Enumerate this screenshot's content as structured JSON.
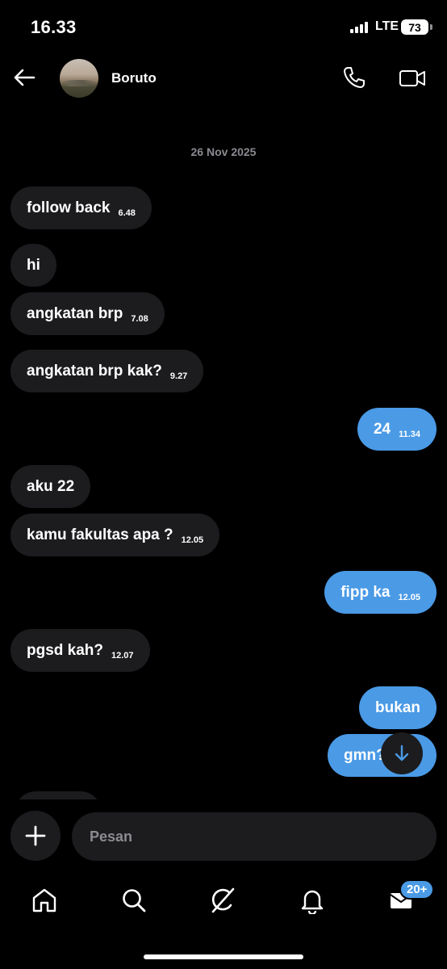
{
  "status_bar": {
    "time": "16.33",
    "network": "LTE",
    "battery": "73"
  },
  "header": {
    "contact_name": "Boruto",
    "back_icon": "arrow-left-icon",
    "call_icon": "phone-icon",
    "video_icon": "video-camera-icon"
  },
  "date_separator": "26 Nov 2025",
  "messages": [
    {
      "direction": "in",
      "text": "follow back",
      "time": "6.48"
    },
    {
      "direction": "in",
      "text": "hi",
      "time": ""
    },
    {
      "direction": "in",
      "text": "angkatan brp",
      "time": "7.08"
    },
    {
      "direction": "in",
      "text": "angkatan brp kak?",
      "time": "9.27"
    },
    {
      "direction": "out",
      "text": "24",
      "time": "11.34"
    },
    {
      "direction": "in",
      "text": "aku 22",
      "time": ""
    },
    {
      "direction": "in",
      "text": "kamu fakultas apa ?",
      "time": "12.05"
    },
    {
      "direction": "out",
      "text": "fipp ka",
      "time": "12.05"
    },
    {
      "direction": "in",
      "text": "pgsd kah?",
      "time": "12.07"
    },
    {
      "direction": "out",
      "text": "bukan",
      "time": ""
    },
    {
      "direction": "out",
      "text": "gmn?",
      "time": ""
    }
  ],
  "composer": {
    "placeholder": "Pesan",
    "add_icon": "plus-icon"
  },
  "bottom_nav": {
    "items": [
      "home-icon",
      "search-icon",
      "grok-icon",
      "bell-icon",
      "mail-icon"
    ],
    "mail_badge": "20+"
  },
  "colors": {
    "background": "#000000",
    "incoming_bubble": "#1c1c1f",
    "outgoing_bubble": "#4a9ae6",
    "muted_text": "#8b8b90"
  }
}
